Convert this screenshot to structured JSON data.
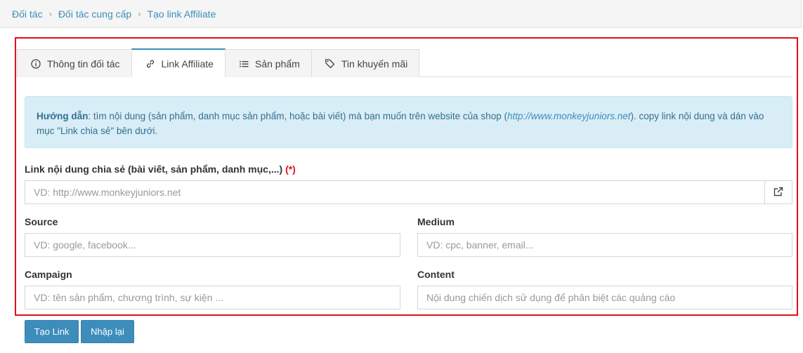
{
  "breadcrumb": [
    "Đối tác",
    "Đối tác cung cấp",
    "Tạo link Affiliate"
  ],
  "tabs": [
    {
      "label": "Thông tin đối tác",
      "icon": "info-icon"
    },
    {
      "label": "Link Affiliate",
      "icon": "link-icon",
      "active": true
    },
    {
      "label": "Sản phẩm",
      "icon": "list-icon"
    },
    {
      "label": "Tin khuyến mãi",
      "icon": "tag-icon"
    }
  ],
  "alert": {
    "bold": "Hướng dẫn",
    "text_before": ": tìm nội dung (sản phẩm, danh mục sản phẩm, hoặc bài viết) mà bạn muốn trên website của shop (",
    "url": "http://www.monkeyjuniors.net",
    "text_after": "). copy link nội dung và dán vào mục \"Link chia sẻ\" bên dưới."
  },
  "form": {
    "link_label": "Link nội dung chia sẻ (bài viết, sản phẩm, danh mục,...)",
    "required_mark": "(*)",
    "link_placeholder": "VD: http://www.monkeyjuniors.net",
    "source_label": "Source",
    "source_placeholder": "VD: google, facebook...",
    "medium_label": "Medium",
    "medium_placeholder": "VD: cpc, banner, email...",
    "campaign_label": "Campaign",
    "campaign_placeholder": "VD: tên sản phẩm, chương trình, sự kiện ...",
    "content_label": "Content",
    "content_placeholder": "Nội dung chiến dịch sử dụng để phân biệt các quảng cáo"
  },
  "buttons": {
    "create": "Tạo Link",
    "reset": "Nhập lại"
  },
  "colors": {
    "primary": "#3c8dbc",
    "highlight_frame": "#e0101a",
    "alert_bg": "#d9edf7"
  }
}
